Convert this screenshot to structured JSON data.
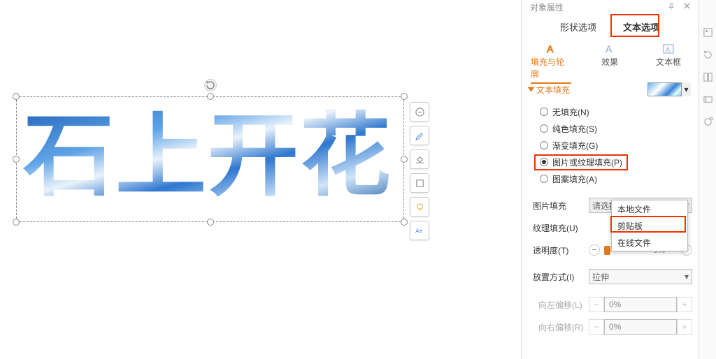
{
  "panel_title": "对象属性",
  "canvas_text": "石上开花",
  "top_tabs": {
    "shape": "形状选项",
    "text": "文本选项"
  },
  "sub_tabs": {
    "fill": "填充与轮廓",
    "effect": "效果",
    "textbox": "文本框"
  },
  "section": {
    "text_fill": "文本填充"
  },
  "fill_options": {
    "none": "无填充(N)",
    "solid": "纯色填充(S)",
    "grad": "渐变填充(G)",
    "pic": "图片或纹理填充(P)",
    "pattern": "图案填充(A)"
  },
  "fields": {
    "pic_fill_label": "图片填充",
    "pic_fill_value": "请选择图片",
    "texture_label": "纹理填充(U)",
    "opacity_label": "透明度(T)",
    "opacity_value": "0%",
    "place_label": "放置方式(I)",
    "place_value": "拉伸",
    "offset_left_label": "向左偏移(L)",
    "offset_right_label": "向右偏移(R)",
    "offset_value": "0%"
  },
  "popup": {
    "local": "本地文件",
    "clipboard": "剪贴板",
    "online": "在线文件"
  }
}
